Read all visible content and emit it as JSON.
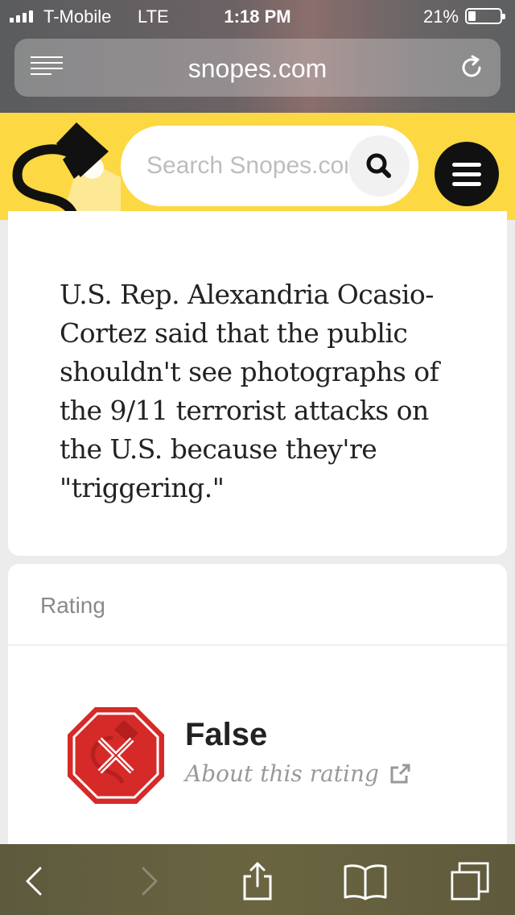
{
  "status_bar": {
    "carrier": "T-Mobile",
    "network": "LTE",
    "time": "1:18 PM",
    "battery": "21%",
    "battery_level": 0.21
  },
  "browser": {
    "url": "snopes.com",
    "icons": [
      "reader-icon",
      "reload-icon"
    ]
  },
  "site_header": {
    "search_placeholder": "Search Snopes.com",
    "brand_color": "#fcd842",
    "icons": [
      "snopes-logo",
      "search-icon",
      "hamburger-menu-icon"
    ]
  },
  "claim": {
    "text": "U.S. Rep. Alexandria Ocasio-Cortez said that the public shouldn't see photographs of the 9/11 terrorist attacks on the U.S. because they're \"triggering.\""
  },
  "rating": {
    "label": "Rating",
    "value": "False",
    "link": "About this rating",
    "badge_color": "#d62a28",
    "icons": [
      "false-rating-icon",
      "external-link-icon"
    ]
  },
  "toolbar": {
    "icons": [
      "back-icon",
      "forward-icon",
      "share-icon",
      "bookmarks-icon",
      "tabs-icon"
    ]
  }
}
